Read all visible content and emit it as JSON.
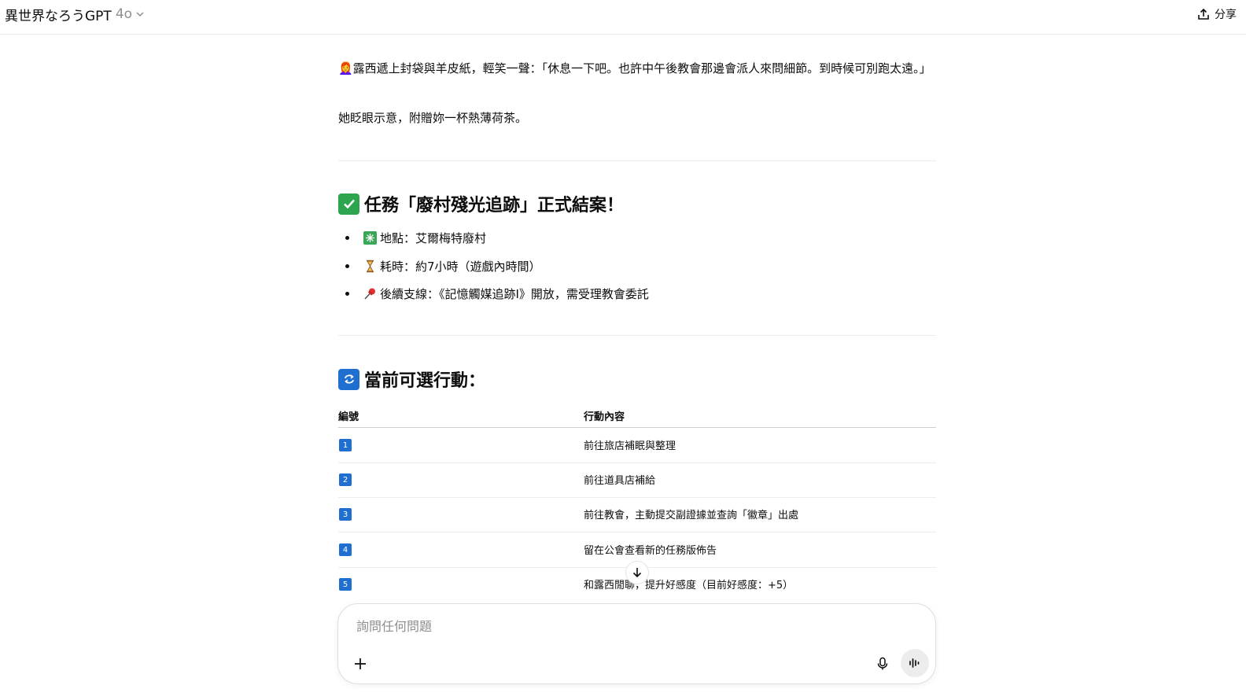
{
  "header": {
    "title": "異世界なろうGPT",
    "model_version": "4o",
    "share_label": "分享"
  },
  "message": {
    "para1": "👩‍🦰露西遞上封袋與羊皮紙，輕笑一聲：「休息一下吧。也許中午後教會那邊會派人來問細節。到時候可別跑太遠。」",
    "para2": "她眨眼示意，附贈妳一杯熱薄荷茶。"
  },
  "quest": {
    "heading": "任務「廢村殘光追跡」正式結案！",
    "heading_icon": "check-mark-icon",
    "items": [
      {
        "icon": "sparkle-icon",
        "text": "地點：艾爾梅特廢村"
      },
      {
        "icon": "hourglass-icon",
        "text": "耗時：約7小時（遊戲內時間）"
      },
      {
        "icon": "pushpin-icon",
        "text": "後續支線：《記憶觸媒追跡Ⅰ》開放，需受理教會委託"
      }
    ]
  },
  "actions": {
    "heading": "當前可選行動：",
    "heading_icon": "repeat-icon",
    "col_num": "編號",
    "col_content": "行動內容",
    "rows": [
      {
        "num": "1",
        "text": "前往旅店補眠與整理"
      },
      {
        "num": "2",
        "text": "前往道具店補給"
      },
      {
        "num": "3",
        "text": "前往教會，主動提交副證據並查詢「徽章」出處"
      },
      {
        "num": "4",
        "text": "留在公會查看新的任務版佈告"
      },
      {
        "num": "5",
        "text": "和露西閒聊，提升好感度（目前好感度：+5）"
      }
    ]
  },
  "composer": {
    "placeholder": "詢問任何問題",
    "value": ""
  },
  "colors": {
    "accent_blue": "#1f6fd1",
    "check_green": "#2da44e",
    "sparkle_green": "#3aa757"
  }
}
